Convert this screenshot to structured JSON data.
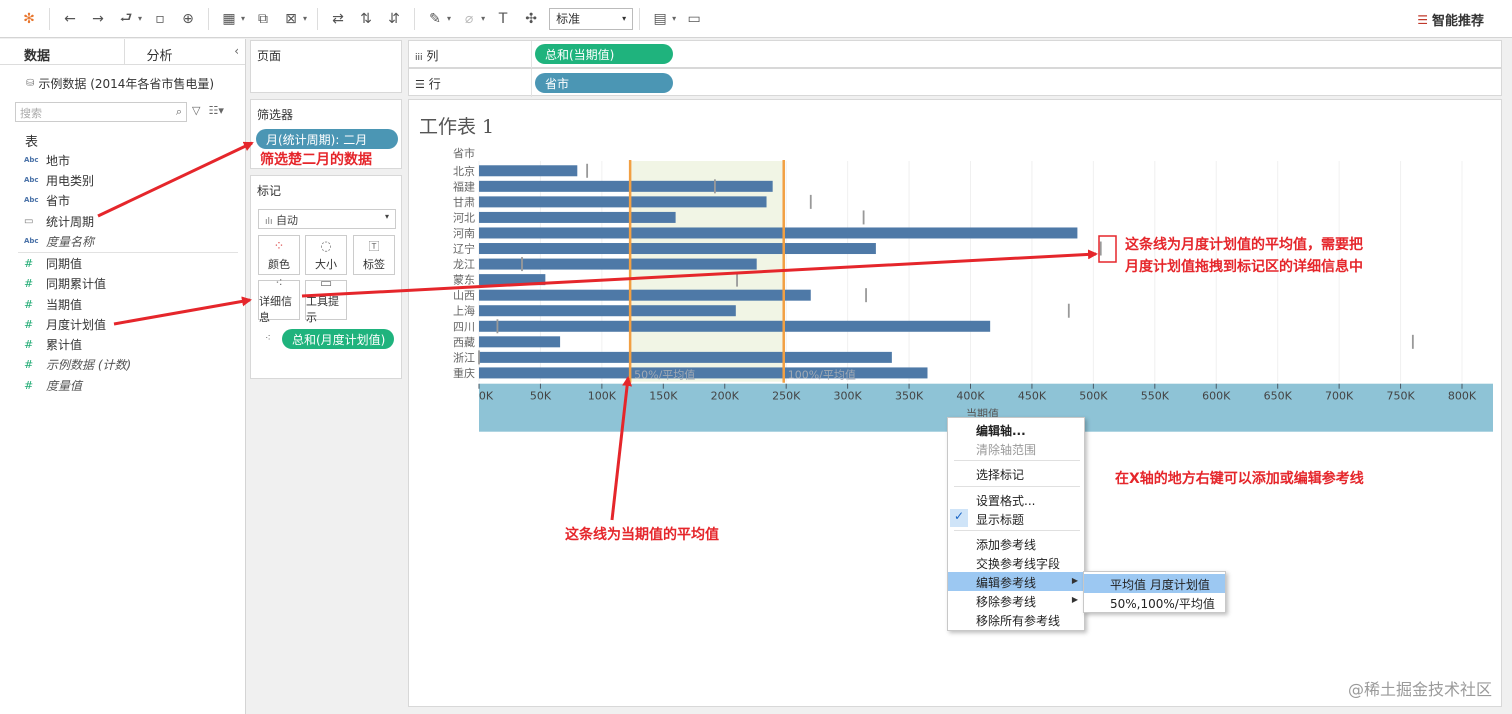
{
  "toolbar": {
    "style_select": "标准",
    "smart_recommend": "智能推荐"
  },
  "left_panel": {
    "tab_data": "数据",
    "tab_analysis": "分析",
    "datasource": "示例数据 (2014年各省市售电量)",
    "search_placeholder": "搜索",
    "section_table": "表",
    "dimensions": [
      {
        "type": "Abc",
        "label": "地市"
      },
      {
        "type": "Abc",
        "label": "用电类别"
      },
      {
        "type": "Abc",
        "label": "省市"
      },
      {
        "type": "date",
        "label": "统计周期"
      },
      {
        "type": "Abc",
        "label": "度量名称"
      }
    ],
    "measures": [
      {
        "type": "#",
        "label": "同期值"
      },
      {
        "type": "#",
        "label": "同期累计值"
      },
      {
        "type": "#",
        "label": "当期值"
      },
      {
        "type": "#",
        "label": "月度计划值"
      },
      {
        "type": "#",
        "label": "累计值"
      },
      {
        "type": "#",
        "label": "示例数据 (计数)"
      },
      {
        "type": "#",
        "label": "度量值"
      }
    ]
  },
  "pages_panel": {
    "title": "页面"
  },
  "filters_panel": {
    "title": "筛选器",
    "pill": "月(统计周期): 二月"
  },
  "marks_panel": {
    "title": "标记",
    "mark_type": "自动",
    "buttons": {
      "color": "颜色",
      "size": "大小",
      "label": "标签",
      "detail": "详细信息",
      "tooltip": "工具提示"
    },
    "detail_pill": "总和(月度计划值)"
  },
  "shelves": {
    "columns_label": "列",
    "columns_pill": "总和(当期值)",
    "rows_label": "行",
    "rows_pill": "省市"
  },
  "worksheet": {
    "title": "工作表 1"
  },
  "chart_data": {
    "type": "bar",
    "orientation": "horizontal",
    "row_header": "省市",
    "categories": [
      "北京",
      "福建",
      "甘肃",
      "河北",
      "河南",
      "辽宁",
      "龙江",
      "蒙东",
      "山西",
      "上海",
      "四川",
      "西藏",
      "浙江",
      "重庆"
    ],
    "series": [
      {
        "name": "总和(当期值)",
        "values": [
          80000,
          239000,
          234000,
          160000,
          487000,
          323000,
          226000,
          54000,
          270000,
          209000,
          416000,
          66000,
          336000,
          365000
        ]
      }
    ],
    "reference_marks": [
      88000,
      192000,
      270000,
      313000,
      96000,
      506000,
      35000,
      210000,
      315000,
      480000,
      15000,
      760000,
      0,
      0
    ],
    "reference_marks_visible": [
      true,
      true,
      true,
      true,
      false,
      true,
      true,
      true,
      true,
      true,
      true,
      true,
      true,
      false
    ],
    "reference_lines": [
      {
        "label": "50%/平均值",
        "value": 123000
      },
      {
        "label": "100%/平均值",
        "value": 248000
      }
    ],
    "xlabel": "当期值",
    "xlim": [
      0,
      820000
    ],
    "xticks": [
      0,
      50000,
      100000,
      150000,
      200000,
      250000,
      300000,
      350000,
      400000,
      450000,
      500000,
      550000,
      600000,
      650000,
      700000,
      750000,
      800000
    ],
    "xtick_labels": [
      "0K",
      "50K",
      "100K",
      "150K",
      "200K",
      "250K",
      "300K",
      "350K",
      "400K",
      "450K",
      "500K",
      "550K",
      "600K",
      "650K",
      "700K",
      "750K",
      "800K"
    ],
    "bar_color": "#4e79a7",
    "band_color": "#f1f5e5",
    "refline_color": "#f2a043"
  },
  "context_menu": {
    "items": [
      "编辑轴...",
      "清除轴范围",
      "选择标记",
      "设置格式...",
      "显示标题",
      "添加参考线",
      "交换参考线字段",
      "编辑参考线",
      "移除参考线",
      "移除所有参考线"
    ],
    "submenu": [
      "平均值 月度计划值",
      "50%,100%/平均值"
    ]
  },
  "annotations": {
    "filter_note": "筛选楚二月的数据",
    "detail_note_line1": "这条线为月度计划值的平均值，需要把",
    "detail_note_line2": "月度计划值拖拽到标记区的详细信息中",
    "avg_note": "这条线为当期值的平均值",
    "axis_note": "在X轴的地方右键可以添加或编辑参考线"
  },
  "watermark": "@稀土掘金技术社区"
}
